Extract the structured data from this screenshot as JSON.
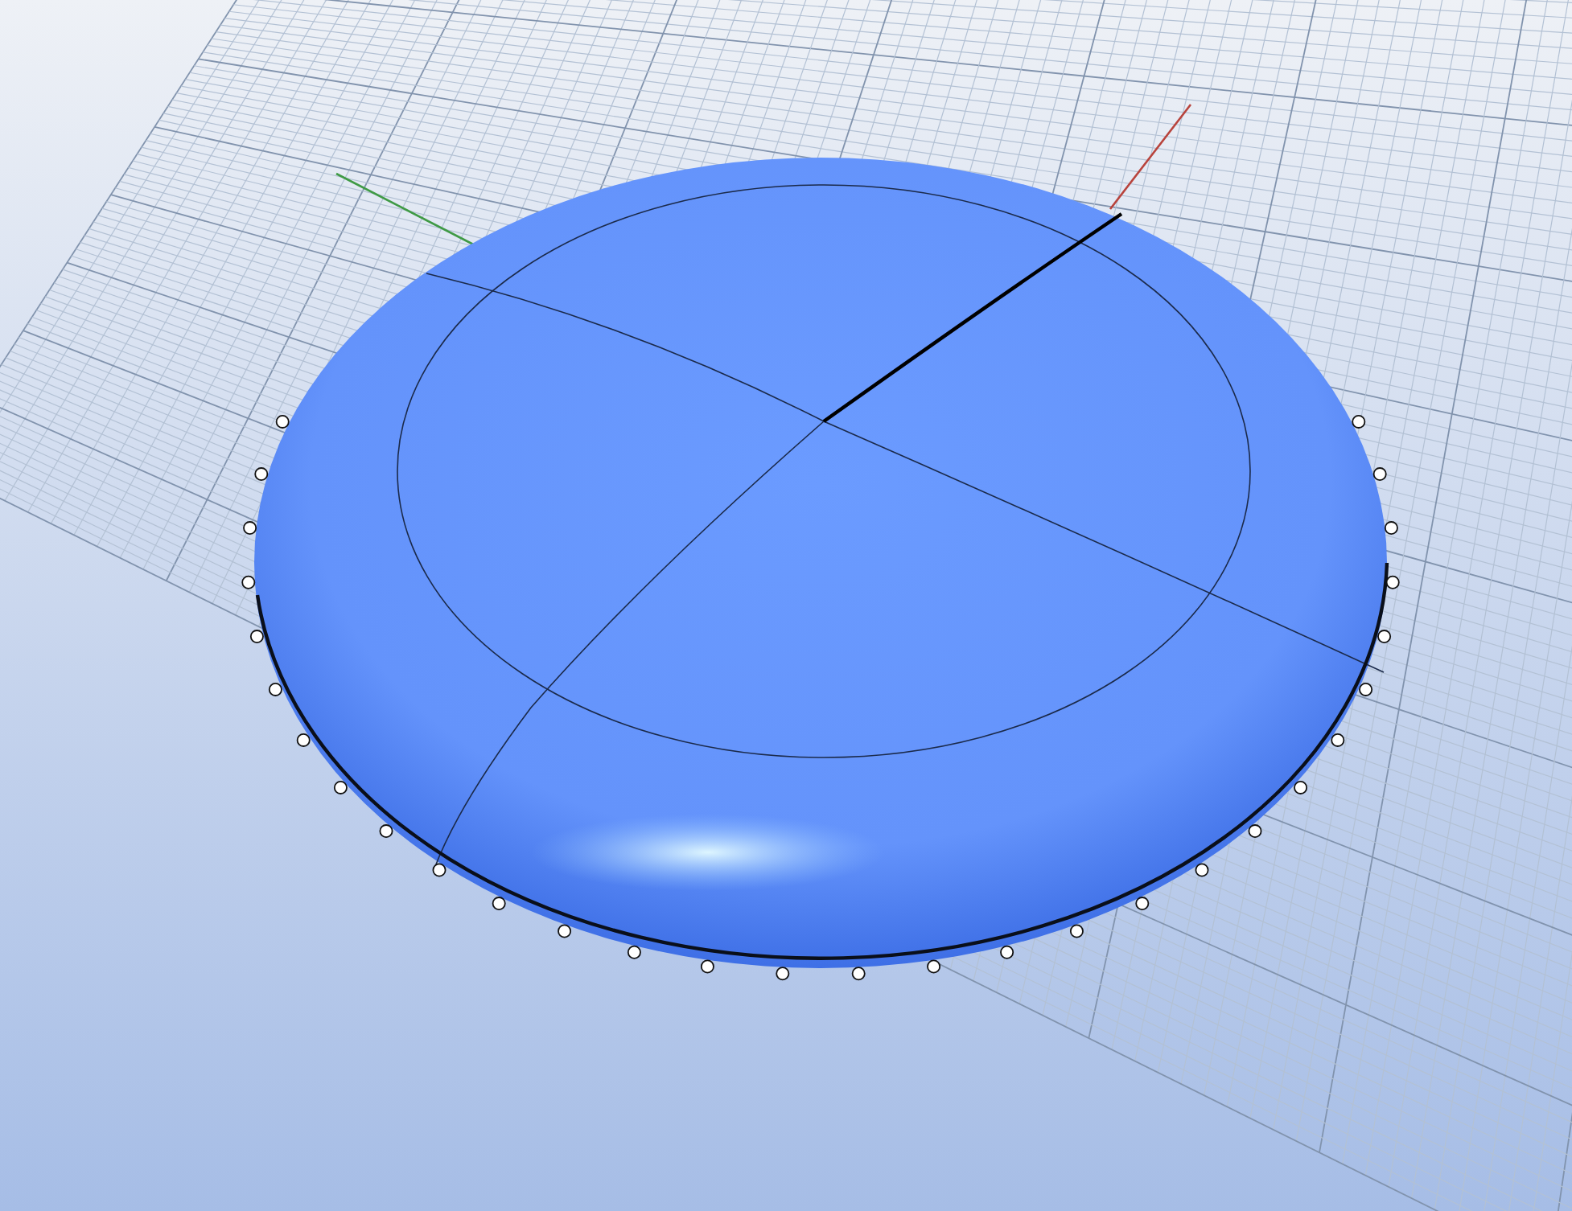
{
  "axes": [
    {
      "color": "#b8433c"
    },
    {
      "color": "#3f9a45"
    }
  ]
}
